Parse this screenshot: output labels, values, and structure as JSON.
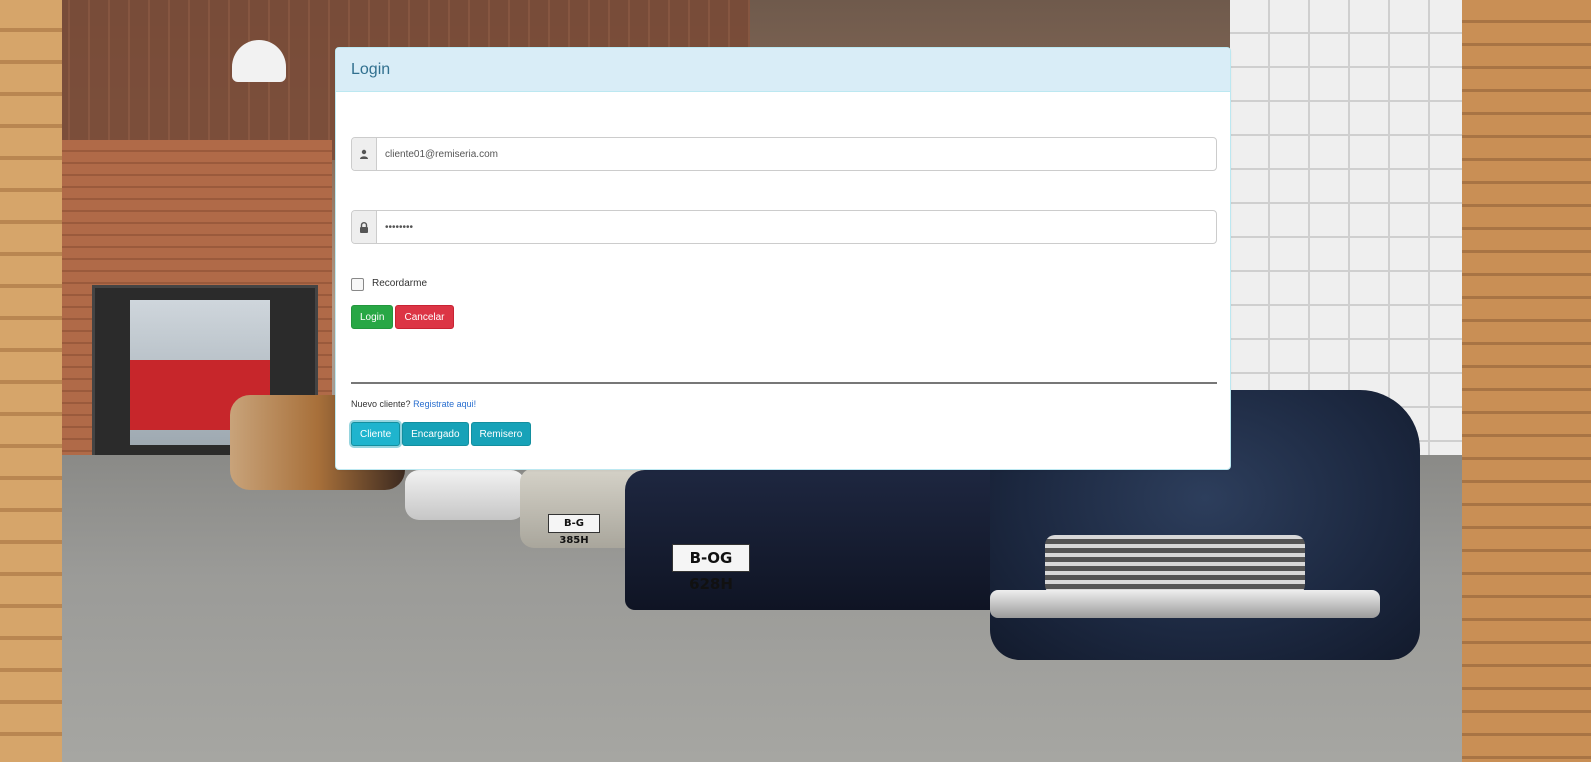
{
  "panel": {
    "title": "Login"
  },
  "form": {
    "email": {
      "icon": "user-icon",
      "value": "cliente01@remiseria.com"
    },
    "password": {
      "icon": "lock-icon",
      "value": "••••••••"
    },
    "remember_label": "Recordarme",
    "remember_checked": false,
    "login_label": "Login",
    "cancel_label": "Cancelar"
  },
  "signup": {
    "prompt": "Nuevo cliente?",
    "link": "Registrate aqui!"
  },
  "roles": [
    {
      "label": "Cliente",
      "active": true
    },
    {
      "label": "Encargado",
      "active": false
    },
    {
      "label": "Remisero",
      "active": false
    }
  ],
  "background": {
    "plate_front": "B-OG 628H",
    "plate_side": "B-G 385H"
  },
  "colors": {
    "heading_bg": "#d9edf7",
    "heading_text": "#31708f",
    "success": "#28a745",
    "danger": "#dc3545",
    "info": "#17a2b8",
    "link": "#2a6fcf"
  }
}
